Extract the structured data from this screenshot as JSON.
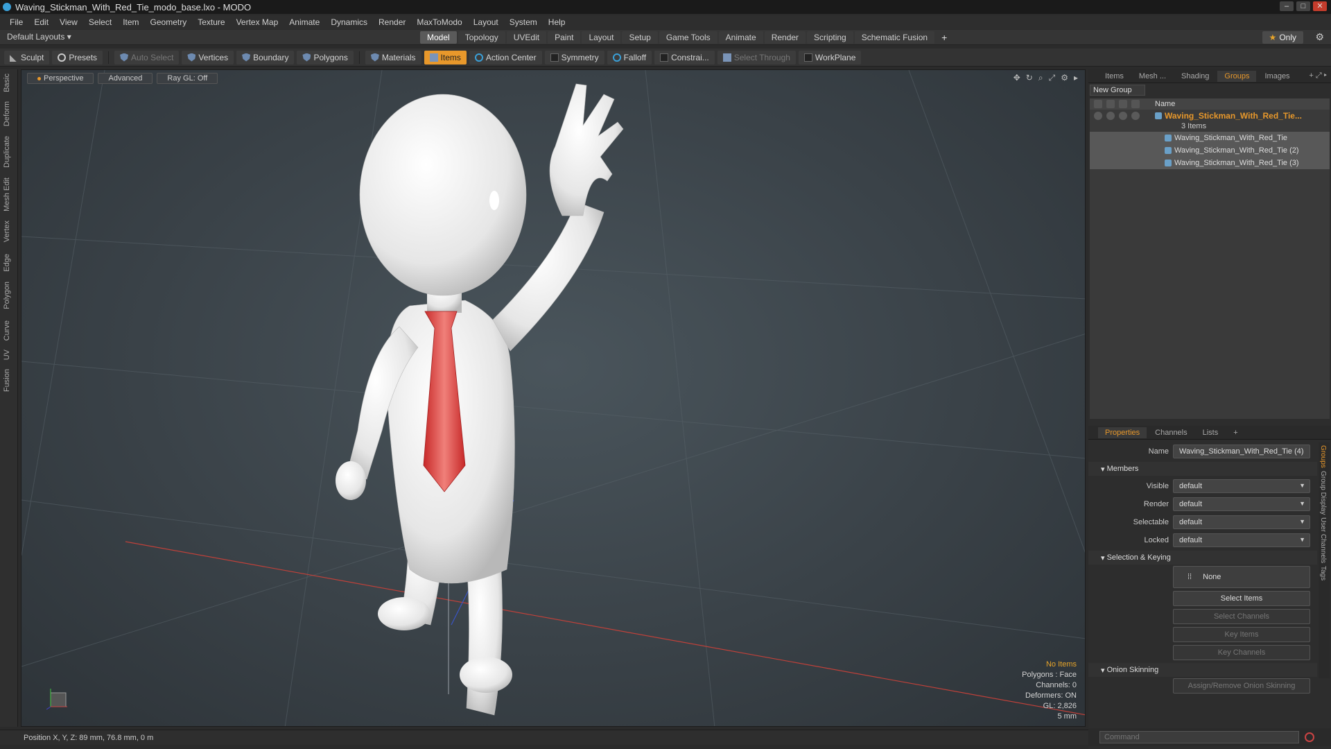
{
  "window": {
    "title": "Waving_Stickman_With_Red_Tie_modo_base.lxo - MODO"
  },
  "menu": [
    "File",
    "Edit",
    "View",
    "Select",
    "Item",
    "Geometry",
    "Texture",
    "Vertex Map",
    "Animate",
    "Dynamics",
    "Render",
    "MaxToModo",
    "Layout",
    "System",
    "Help"
  ],
  "layoutbar": {
    "layout_dropdown": "Default Layouts",
    "tabs": [
      "Model",
      "Topology",
      "UVEdit",
      "Paint",
      "Layout",
      "Setup",
      "Game Tools",
      "Animate",
      "Render",
      "Scripting",
      "Schematic Fusion"
    ],
    "active_tab": "Model",
    "only_label": "Only"
  },
  "toolbar": {
    "sculpt": "Sculpt",
    "presets": "Presets",
    "auto_select": "Auto Select",
    "vertices": "Vertices",
    "boundary": "Boundary",
    "polygons": "Polygons",
    "materials": "Materials",
    "items": "Items",
    "action_center": "Action Center",
    "symmetry": "Symmetry",
    "falloff": "Falloff",
    "constraints": "Constrai...",
    "select_through": "Select Through",
    "workplane": "WorkPlane"
  },
  "left_tabs": [
    "Basic",
    "Deform",
    "Duplicate",
    "Mesh Edit",
    "Vertex",
    "Edge",
    "Polygon",
    "Curve",
    "UV",
    "Fusion"
  ],
  "viewport": {
    "view_mode": "Perspective",
    "shading": "Advanced",
    "raygl": "Ray GL: Off",
    "info": {
      "no_items": "No Items",
      "polygons": "Polygons : Face",
      "channels": "Channels: 0",
      "deformers": "Deformers: ON",
      "gl": "GL: 2,826",
      "scale": "5 mm"
    }
  },
  "status": {
    "position": "Position X, Y, Z:  89 mm, 76.8 mm, 0 m"
  },
  "groups_panel": {
    "tabs": [
      "Items",
      "Mesh ...",
      "Shading",
      "Groups",
      "Images"
    ],
    "active_tab": "Groups",
    "new_group": "New Group",
    "name_header": "Name",
    "group_name": "Waving_Stickman_With_Red_Tie...",
    "group_count": "3 Items",
    "items": [
      "Waving_Stickman_With_Red_Tie",
      "Waving_Stickman_With_Red_Tie (2)",
      "Waving_Stickman_With_Red_Tie (3)"
    ]
  },
  "properties": {
    "tabs": [
      "Properties",
      "Channels",
      "Lists"
    ],
    "active_tab": "Properties",
    "name_label": "Name",
    "name_value": "Waving_Stickman_With_Red_Tie (4)",
    "members_section": "Members",
    "visible_label": "Visible",
    "visible_value": "default",
    "render_label": "Render",
    "render_value": "default",
    "selectable_label": "Selectable",
    "selectable_value": "default",
    "locked_label": "Locked",
    "locked_value": "default",
    "selection_section": "Selection & Keying",
    "none_label": "None",
    "select_items": "Select Items",
    "select_channels": "Select Channels",
    "key_items": "Key Items",
    "key_channels": "Key Channels",
    "onion_section": "Onion Skinning",
    "onion_button": "Assign/Remove Onion Skinning",
    "side_tabs": [
      "Groups",
      "Group Display",
      "User Channels",
      "Tags"
    ]
  },
  "command": {
    "placeholder": "Command"
  },
  "colors": {
    "accent": "#e8982b",
    "tie": "#e03a3a",
    "viewport": "#3a4248"
  }
}
